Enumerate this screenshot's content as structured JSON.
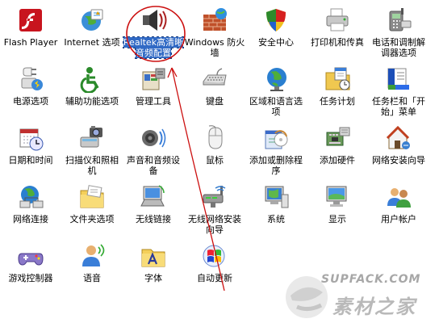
{
  "control_panel": {
    "items": [
      {
        "label": "Flash Player",
        "icon": "flash-player-icon"
      },
      {
        "label": "Internet 选项",
        "icon": "internet-options-icon"
      },
      {
        "label": "Realtek高清晰音频配置",
        "icon": "realtek-audio-icon",
        "selected": true
      },
      {
        "label": "Windows 防火墙",
        "icon": "firewall-icon"
      },
      {
        "label": "安全中心",
        "icon": "security-center-icon"
      },
      {
        "label": "打印机和传真",
        "icon": "printer-fax-icon"
      },
      {
        "label": "电话和调制解调器选项",
        "icon": "phone-modem-icon"
      },
      {
        "label": "电源选项",
        "icon": "power-options-icon"
      },
      {
        "label": "辅助功能选项",
        "icon": "accessibility-icon"
      },
      {
        "label": "管理工具",
        "icon": "admin-tools-icon"
      },
      {
        "label": "键盘",
        "icon": "keyboard-icon"
      },
      {
        "label": "区域和语言选项",
        "icon": "region-language-icon"
      },
      {
        "label": "任务计划",
        "icon": "scheduled-tasks-icon"
      },
      {
        "label": "任务栏和「开始」菜单",
        "icon": "taskbar-start-menu-icon"
      },
      {
        "label": "日期和时间",
        "icon": "date-time-icon"
      },
      {
        "label": "扫描仪和照相机",
        "icon": "scanner-camera-icon"
      },
      {
        "label": "声音和音频设备",
        "icon": "sound-audio-icon"
      },
      {
        "label": "鼠标",
        "icon": "mouse-icon"
      },
      {
        "label": "添加或删除程序",
        "icon": "add-remove-programs-icon"
      },
      {
        "label": "添加硬件",
        "icon": "add-hardware-icon"
      },
      {
        "label": "网络安装向导",
        "icon": "network-setup-wizard-icon"
      },
      {
        "label": "网络连接",
        "icon": "network-connections-icon"
      },
      {
        "label": "文件夹选项",
        "icon": "folder-options-icon"
      },
      {
        "label": "无线链接",
        "icon": "wireless-link-icon"
      },
      {
        "label": "无线网络安装向导",
        "icon": "wireless-network-wizard-icon"
      },
      {
        "label": "系统",
        "icon": "system-icon"
      },
      {
        "label": "显示",
        "icon": "display-icon"
      },
      {
        "label": "用户帐户",
        "icon": "user-accounts-icon"
      },
      {
        "label": "游戏控制器",
        "icon": "game-controllers-icon"
      },
      {
        "label": "语音",
        "icon": "speech-icon"
      },
      {
        "label": "字体",
        "icon": "fonts-icon"
      },
      {
        "label": "自动更新",
        "icon": "automatic-updates-icon"
      }
    ]
  },
  "annotation": {
    "color": "#cc1010"
  },
  "watermark": {
    "site_text": "SUPFACK.COM",
    "cn_text": "素材之家"
  },
  "colors": {
    "selection": "#316ac5"
  }
}
